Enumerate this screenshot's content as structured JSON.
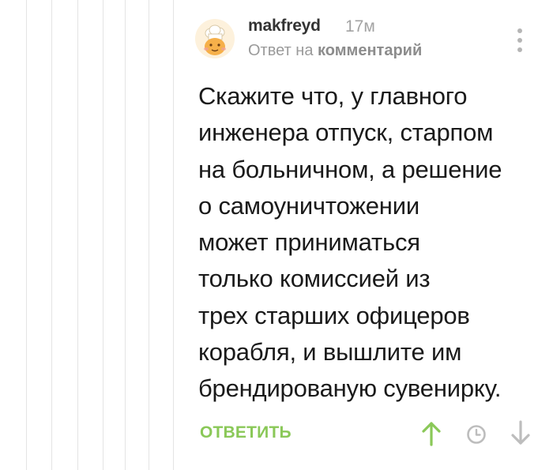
{
  "comment": {
    "author": "makfreyd",
    "time": "17м",
    "reply_prefix": "Ответ на",
    "reply_target": "комментарий",
    "body_lines": [
      "Скажите что, у главного",
      "инженера отпуск, старпом",
      "на больничном, а решение",
      "о самоуничтожении",
      "может приниматься",
      "только комиссией из",
      "трех старших офицеров",
      "корабля, и вышлите им",
      "брендированую сувенирку."
    ],
    "reply_label": "ОТВЕТИТЬ",
    "icons": {
      "avatar": "chef-avatar-icon",
      "menu": "more-vertical-icon",
      "upvote": "arrow-up-icon",
      "later": "clock-icon",
      "downvote": "arrow-down-icon"
    },
    "colors": {
      "accent_green": "#8ac858",
      "text": "#1a1a1a",
      "muted": "#a3a3a3",
      "thread_line": "#e4e4e4"
    }
  }
}
